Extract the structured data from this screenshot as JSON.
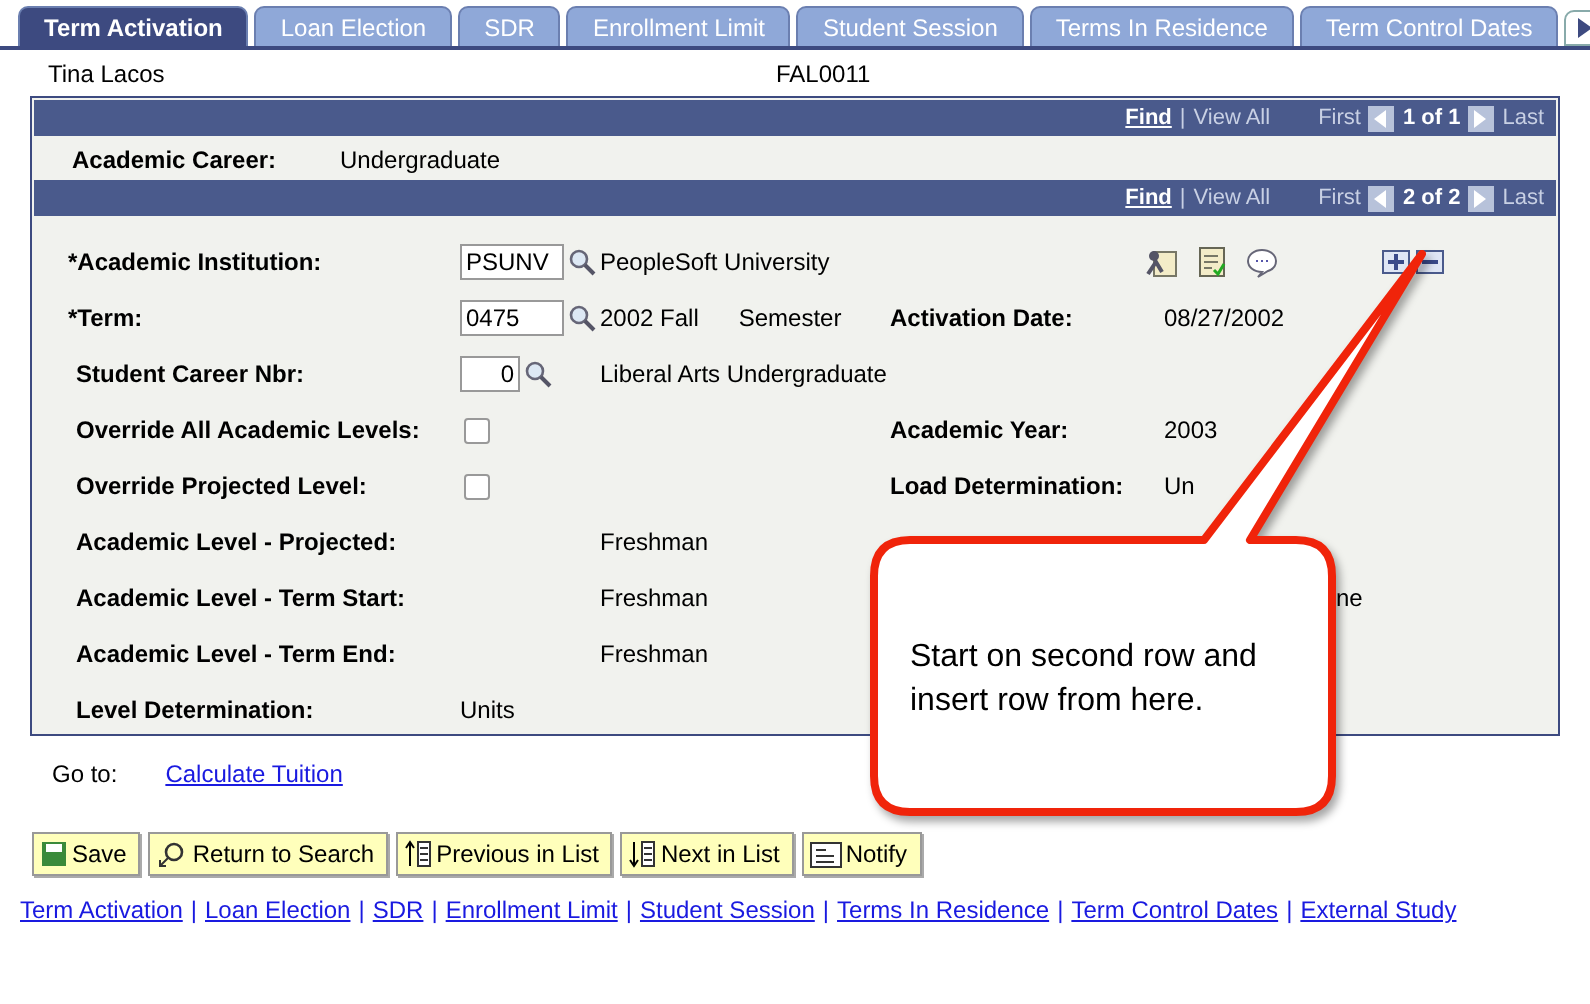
{
  "tabs": [
    {
      "label": "Term Activation",
      "selected": true
    },
    {
      "label": "Loan Election",
      "selected": false
    },
    {
      "label": "SDR",
      "selected": false
    },
    {
      "label": "Enrollment Limit",
      "selected": false
    },
    {
      "label": "Student Session",
      "selected": false
    },
    {
      "label": "Terms In Residence",
      "selected": false
    },
    {
      "label": "Term Control Dates",
      "selected": false
    }
  ],
  "student": {
    "name": "Tina Lacos",
    "id": "FAL0011"
  },
  "outer_nav": {
    "find": "Find",
    "separator": "|",
    "view_all": "View All",
    "first": "First",
    "count": "1 of 1",
    "last": "Last"
  },
  "career": {
    "label": "Academic Career:",
    "value": "Undergraduate"
  },
  "inner_nav": {
    "find": "Find",
    "separator": "|",
    "view_all": "View All",
    "first": "First",
    "count": "2 of 2",
    "last": "Last"
  },
  "rows": [
    {
      "kind": "lookup",
      "label": "*Academic Institution:",
      "value": "PSUNV",
      "description": "PeopleSoft University"
    },
    {
      "kind": "lookup",
      "label": "*Term:",
      "value": "0475",
      "description": "2002 Fall",
      "description_2": "Semester",
      "right_label": "Activation Date:",
      "right_value": "08/27/2002"
    },
    {
      "kind": "lookup",
      "label": "Student Career Nbr:",
      "value": "0",
      "description": "Liberal Arts Undergraduate"
    },
    {
      "kind": "checkbox",
      "label": "Override All Academic Levels:",
      "checked": false,
      "right_label": "Academic Year:",
      "right_value": "2003"
    },
    {
      "kind": "checkbox",
      "label": "Override Projected Level:",
      "checked": false,
      "right_label": "Load Determination:",
      "right_value": "Un"
    },
    {
      "kind": "text",
      "label": "Academic Level - Projected:",
      "description": "Freshman"
    },
    {
      "kind": "text",
      "label": "Academic Level - Term Start:",
      "description": "Freshman",
      "far_value": "ne"
    },
    {
      "kind": "text",
      "label": "Academic Level - Term End:",
      "description": "Freshman"
    },
    {
      "kind": "plain",
      "label": "Level Determination:",
      "value": "Units"
    }
  ],
  "goto": {
    "label": "Go to:",
    "link": "Calculate Tuition"
  },
  "buttons": [
    {
      "kind": "save",
      "label": "Save"
    },
    {
      "kind": "search",
      "label": "Return to Search"
    },
    {
      "kind": "previous",
      "label": "Previous in List"
    },
    {
      "kind": "next",
      "label": "Next in List"
    },
    {
      "kind": "notify",
      "label": "Notify"
    }
  ],
  "footer_links": [
    {
      "label": "Term Activation"
    },
    {
      "separator_before": "|",
      "label": "Loan Election"
    },
    {
      "separator_before": "|",
      "label": "SDR"
    },
    {
      "separator_before": "|",
      "label": "Enrollment Limit"
    },
    {
      "separator_before": "|",
      "label": "Student Session"
    },
    {
      "separator_before": "|",
      "label": "Terms In Residence"
    },
    {
      "separator_before": "|",
      "label": "Term Control Dates"
    },
    {
      "separator_before": "|",
      "label": "External Study"
    }
  ],
  "callout": {
    "text": "Start on second row and insert row from here."
  }
}
